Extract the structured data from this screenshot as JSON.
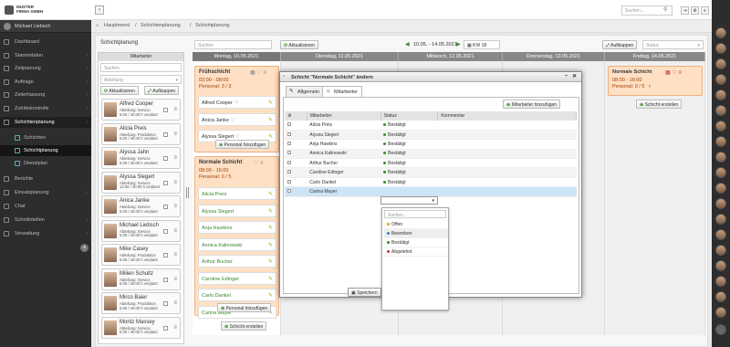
{
  "app": {
    "logo_line1": "MUSTER",
    "logo_line2": "FIRMA GMBH",
    "user_name": "Michael Liebsch",
    "search_placeholder": "Suchen..."
  },
  "sidebar": {
    "items": [
      {
        "label": "Dashboard",
        "icon": "dashboard-icon"
      },
      {
        "label": "Stammdaten",
        "icon": "database-icon"
      },
      {
        "label": "Zeitplanung",
        "icon": "calendar-icon"
      },
      {
        "label": "Aufträge",
        "icon": "clipboard-icon"
      },
      {
        "label": "Zeiterfassung",
        "icon": "clock-icon"
      },
      {
        "label": "Zutrittskontrolle",
        "icon": "door-icon"
      },
      {
        "label": "Schichtenplanung",
        "icon": "shift-icon"
      },
      {
        "label": "Schichten",
        "icon": "list-icon"
      },
      {
        "label": "Schichtplanung",
        "icon": "plan-icon"
      },
      {
        "label": "Dienstplan",
        "icon": "roster-icon"
      },
      {
        "label": "Berichte",
        "icon": "report-icon"
      },
      {
        "label": "Einsatzplanung",
        "icon": "deploy-icon"
      },
      {
        "label": "Chat",
        "icon": "chat-icon"
      },
      {
        "label": "Schnittstellen",
        "icon": "plug-icon"
      },
      {
        "label": "Verwaltung",
        "icon": "gear-icon"
      }
    ]
  },
  "breadcrumb": {
    "home": "Hauptmenü",
    "section": "Schichtenplanung",
    "page": "Schichtplanung"
  },
  "toolbar": {
    "panel_title": "Schichtplanung",
    "search_placeholder": "Suchen",
    "refresh": "Aktualisieren",
    "date_range": "10.05. - 14.05.2021",
    "week": "KW 18",
    "expand": "Aufklappen",
    "status_placeholder": "Status"
  },
  "employees": {
    "header": "Mitarbeiter",
    "search_placeholder": "Suchen",
    "filter_placeholder": "Abteilung",
    "refresh": "Aktualisieren",
    "expand": "Aufklappen",
    "list": [
      {
        "name": "Alfred Cooper",
        "line1": "Abteilung: Service",
        "line2": "5.00 / 40.00 h verplant"
      },
      {
        "name": "Alicia Preis",
        "line1": "Abteilung: Produktion",
        "line2": "5.00 / 40.00 h verplant"
      },
      {
        "name": "Alyssa Jahn",
        "line1": "Abteilung: Service",
        "line2": "5.00 / 40.00 h verplant"
      },
      {
        "name": "Alyssa Slegert",
        "line1": "Abteilung: Service",
        "line2": "13.00 / 40.00 h verplant"
      },
      {
        "name": "Anica Janke",
        "line1": "Abteilung: Service",
        "line2": "5.00 / 40.00 h verplant"
      },
      {
        "name": "Michael Liebsch",
        "line1": "Abteilung: Service",
        "line2": "5.00 / 40.00 h verplant"
      },
      {
        "name": "Mike Casey",
        "line1": "Abteilung: Produktion",
        "line2": "5.00 / 40.00 h verplant"
      },
      {
        "name": "Milien Schultz",
        "line1": "Abteilung: Service",
        "line2": "5.00 / 40.00 h verplant"
      },
      {
        "name": "Mirco Baier",
        "line1": "Abteilung: Produktion",
        "line2": "5.00 / 40.00 h verplant"
      },
      {
        "name": "Moritz Massey",
        "line1": "Abteilung: Service",
        "line2": "5.00 / 40.00 h verplant"
      }
    ]
  },
  "days": [
    "Montag, 10.05.2021",
    "Dienstag, 11.05.2021",
    "Mittwoch, 12.05.2021",
    "Donnerstag, 13.05.2021",
    "Freitag, 14.05.2021"
  ],
  "monday": {
    "early": {
      "title": "Frühschicht",
      "time": "03:00 - 08:00",
      "staff": "Personal: 3 / 3",
      "members": [
        "Alfred Cooper",
        "Anica Janke",
        "Alyssa Slegert"
      ],
      "add": "Personal hinzufügen"
    },
    "normal": {
      "title": "Normale Schicht",
      "time": "08:00 - 16:00",
      "staff": "Personal: 0 / 5",
      "members": [
        "Alicia Preis",
        "Alyssa Slegert",
        "Anja Hawkins",
        "Annica Kalinowski",
        "Arthur Bucher",
        "Caroline Edinger",
        "Carlo Dankel",
        "Carina Mayer"
      ],
      "add": "Personal hinzufügen"
    },
    "create": "Schicht erstellen"
  },
  "friday": {
    "title": "Normale Schicht",
    "time": "08:00 - 16:00",
    "staff": "Personal: 0 / 5",
    "create": "Schicht erstellen"
  },
  "dialog": {
    "title": "Schicht \"Normale Schicht\" ändern",
    "tab_general": "Allgemein",
    "tab_staff": "Mitarbeiter",
    "add_staff": "Mitarbeiter hinzufügen",
    "col_staff": "Mitarbeiter",
    "col_status": "Status",
    "col_comment": "Kommentar",
    "save": "Speichern",
    "rows": [
      {
        "name": "Alicia Preis",
        "status": "Bestätigt"
      },
      {
        "name": "Alyssa Slegert",
        "status": "Bestätigt"
      },
      {
        "name": "Anja Hawkins",
        "status": "Bestätigt"
      },
      {
        "name": "Annica Kalinowski",
        "status": "Bestätigt"
      },
      {
        "name": "Arthur Bucher",
        "status": "Bestätigt"
      },
      {
        "name": "Caroline Edinger",
        "status": "Bestätigt"
      },
      {
        "name": "Carlo Dankel",
        "status": "Bestätigt"
      },
      {
        "name": "Carina Mayer",
        "status": ""
      }
    ],
    "dropdown": {
      "search_placeholder": "Suchen...",
      "options": [
        {
          "label": "Offen",
          "color": "#e8a000"
        },
        {
          "label": "Beworben",
          "color": "#3a7ad0"
        },
        {
          "label": "Bestätigt",
          "color": "#3a8a2a"
        },
        {
          "label": "Abgelehnt",
          "color": "#d03030"
        }
      ]
    }
  }
}
